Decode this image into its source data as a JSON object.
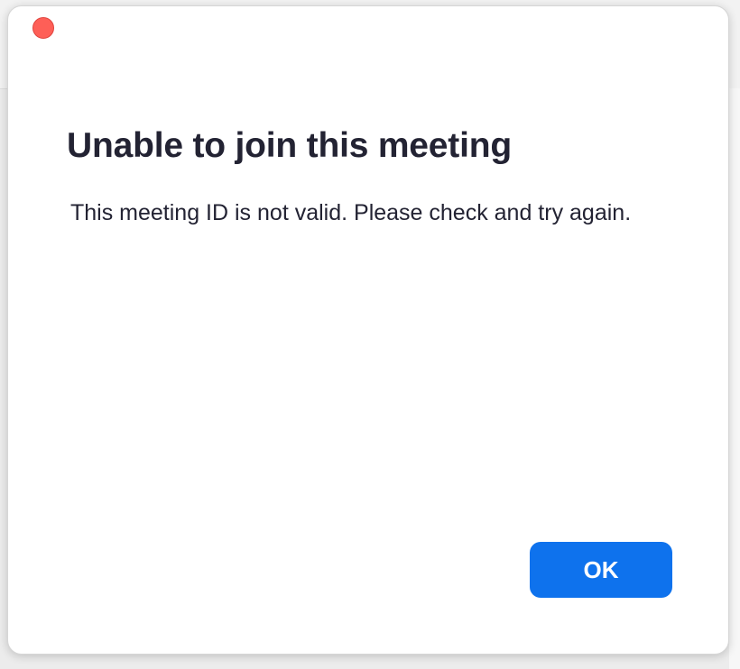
{
  "dialog": {
    "title": "Unable to join this meeting",
    "message": "This meeting ID is not valid. Please check and try again.",
    "ok_label": "OK"
  },
  "colors": {
    "accent": "#0e72ed",
    "close": "#fe5f57",
    "text": "#232333"
  }
}
